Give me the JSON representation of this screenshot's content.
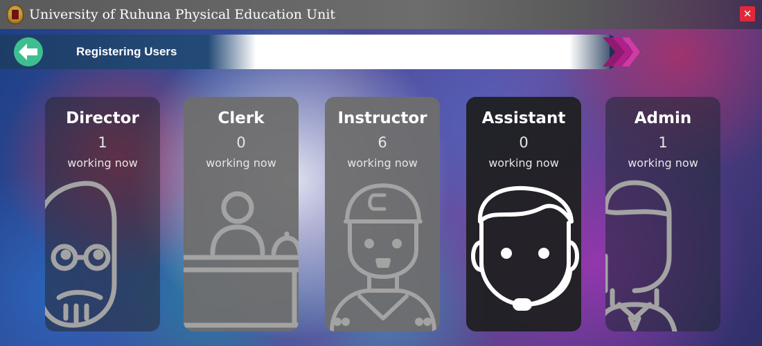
{
  "window": {
    "title": "University of Ruhuna Physical Education Unit",
    "close_label": "✕"
  },
  "header": {
    "title": "Registering Users"
  },
  "cards": [
    {
      "role": "Director",
      "count": "1",
      "status": "working now",
      "icon": "director-avatar-icon"
    },
    {
      "role": "Clerk",
      "count": "0",
      "status": "working now",
      "icon": "clerk-desk-icon"
    },
    {
      "role": "Instructor",
      "count": "6",
      "status": "working now",
      "icon": "instructor-cap-icon"
    },
    {
      "role": "Assistant",
      "count": "0",
      "status": "working now",
      "icon": "headset-assistant-icon"
    },
    {
      "role": "Admin",
      "count": "1",
      "status": "working now",
      "icon": "admin-person-icon"
    }
  ],
  "colors": {
    "back_button": "#3fbf91",
    "close_button": "#e0283a",
    "chevrons": "#b21f8a",
    "outline_gray": "#a3a3a3",
    "outline_white": "#ffffff"
  }
}
